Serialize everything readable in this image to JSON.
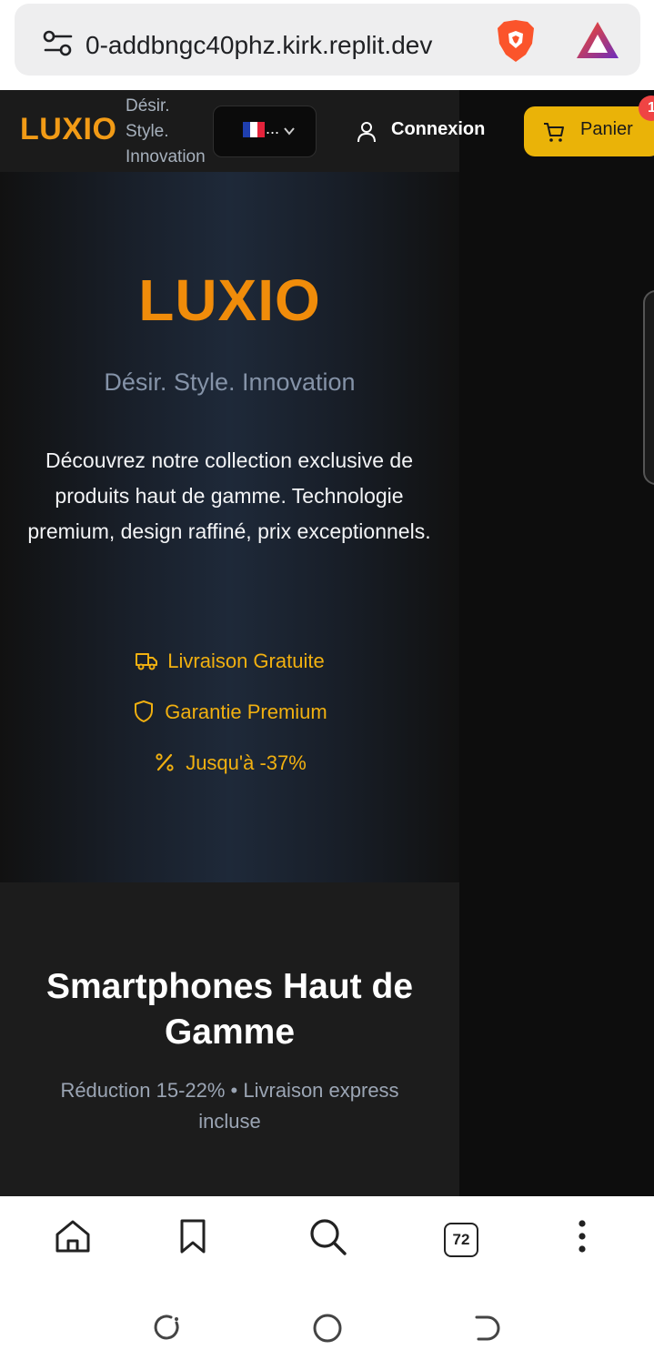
{
  "browser": {
    "url": "0-addbngc40phz.kirk.replit.dev",
    "tab_count": "72"
  },
  "header": {
    "logo": "LUXIO",
    "tagline_lines": [
      "Désir.",
      "Style.",
      "Innovation"
    ],
    "language_selected": "...",
    "login_label": "Connexion",
    "cart_label": "Panier",
    "cart_count": "1"
  },
  "hero": {
    "title": "LUXIO",
    "subtitle": "Désir. Style. Innovation",
    "description": "Découvrez notre collection exclusive de produits haut de gamme. Technologie premium, design raffiné, prix exceptionnels.",
    "features": [
      {
        "icon": "truck-icon",
        "label": "Livraison Gratuite"
      },
      {
        "icon": "shield-icon",
        "label": "Garantie Premium"
      },
      {
        "icon": "percent-icon",
        "label": "Jusqu'à -37%"
      }
    ]
  },
  "section": {
    "title": "Smartphones Haut de Gamme",
    "subtitle": "Réduction 15-22% • Livraison express incluse"
  },
  "colors": {
    "accent": "#f08c0a",
    "cart_button": "#eab308",
    "feature_text": "#f1b010"
  }
}
